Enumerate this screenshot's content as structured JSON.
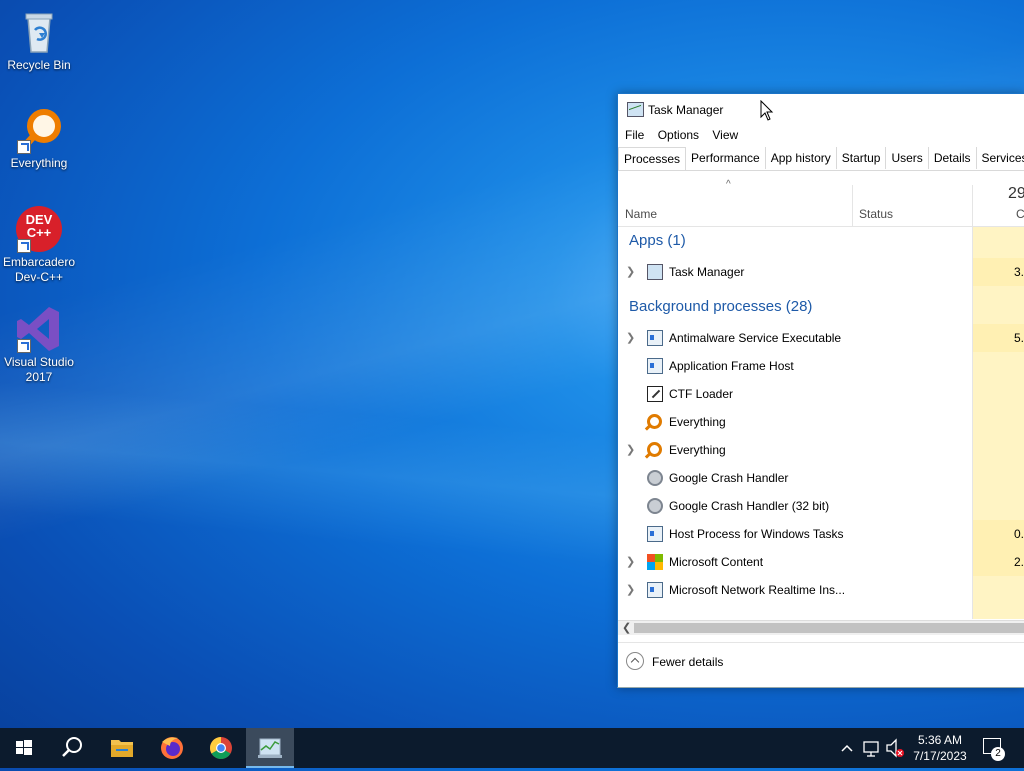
{
  "desktop": {
    "icons": [
      {
        "label": "Recycle Bin",
        "icon": "recycle-bin-icon"
      },
      {
        "label": "Everything",
        "icon": "everything-icon"
      },
      {
        "label": "Embarcadero Dev-C++",
        "icon": "devcpp-icon",
        "badge_text": "DEV C++"
      },
      {
        "label": "Visual Studio 2017",
        "icon": "visual-studio-icon"
      }
    ]
  },
  "task_manager": {
    "title": "Task Manager",
    "menu": [
      "File",
      "Options",
      "View"
    ],
    "tabs": [
      "Processes",
      "Performance",
      "App history",
      "Startup",
      "Users",
      "Details",
      "Services"
    ],
    "active_tab": "Processes",
    "columns": {
      "sort_indicator": "^",
      "name": "Name",
      "status": "Status",
      "cpu_percent": "29",
      "cpu": "C"
    },
    "groups": {
      "apps": "Apps (1)",
      "background": "Background processes (28)"
    },
    "apps": [
      {
        "name": "Task Manager",
        "icon": "task-manager-icon",
        "expandable": true,
        "cpu": "3."
      }
    ],
    "background": [
      {
        "name": "Antimalware Service Executable",
        "icon": "app-window-icon",
        "expandable": true,
        "cpu": "5."
      },
      {
        "name": "Application Frame Host",
        "icon": "app-window-icon",
        "expandable": false,
        "cpu": ""
      },
      {
        "name": "CTF Loader",
        "icon": "notepad-icon",
        "expandable": false,
        "cpu": ""
      },
      {
        "name": "Everything",
        "icon": "everything-search-icon",
        "expandable": false,
        "cpu": ""
      },
      {
        "name": "Everything",
        "icon": "everything-search-icon",
        "expandable": true,
        "cpu": ""
      },
      {
        "name": "Google Crash Handler",
        "icon": "gear-icon",
        "expandable": false,
        "cpu": ""
      },
      {
        "name": "Google Crash Handler (32 bit)",
        "icon": "gear-icon",
        "expandable": false,
        "cpu": ""
      },
      {
        "name": "Host Process for Windows Tasks",
        "icon": "app-window-icon",
        "expandable": false,
        "cpu": "0."
      },
      {
        "name": "Microsoft Content",
        "icon": "microsoft-logo-icon",
        "expandable": true,
        "cpu": "2."
      },
      {
        "name": "Microsoft Network Realtime Ins...",
        "icon": "app-window-icon",
        "expandable": true,
        "cpu": ""
      }
    ],
    "fewer_details": "Fewer details"
  },
  "taskbar": {
    "buttons": [
      "start-icon",
      "search-icon",
      "file-explorer-icon",
      "firefox-icon",
      "chrome-icon",
      "task-manager-icon"
    ],
    "clock_time": "5:36 AM",
    "clock_date": "7/17/2023",
    "notification_count": "2"
  }
}
